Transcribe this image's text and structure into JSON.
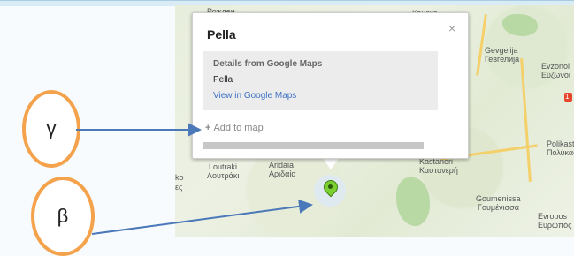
{
  "popup": {
    "title": "Pella",
    "close_label": "×",
    "details_title": "Details from Google Maps",
    "place_name": "Pella",
    "view_link": "View in Google Maps",
    "add_plus": "+",
    "add_label": "Add to map"
  },
  "callouts": {
    "gamma": "γ",
    "beta": "β"
  },
  "map_labels": {
    "rozhden": "Рожден",
    "konsko": "Конско",
    "gevgelija": "Gevgelija",
    "gevgelija_cyr": "Гевгелија",
    "evzonoi": "Evzonoi",
    "evzonoi_gr": "Εύζωνοι",
    "loutraki": "Loutraki",
    "loutraki_gr": "Λουτράκι",
    "aridaia": "Aridaia",
    "aridaia_gr": "Αριδαία",
    "kastaneri": "Kastaneri",
    "kastaneri_gr": "Καστανερή",
    "polikastro": "Polikast",
    "polikastro_gr": "Πολύκασ",
    "goumenissa": "Goumenissa",
    "goumenissa_gr": "Γουμένισσα",
    "evropos": "Evropos",
    "evropos_gr": "Ευρωπός",
    "ko": "ko",
    "es": "ες",
    "shield_1": "1"
  },
  "colors": {
    "callout_border": "#f4a24c",
    "arrow": "#4a78b8",
    "marker_pin": "#7ccf30",
    "link": "#3d70c7"
  },
  "icons": {
    "close": "close-icon",
    "add": "plus-icon",
    "marker": "map-marker-icon"
  }
}
